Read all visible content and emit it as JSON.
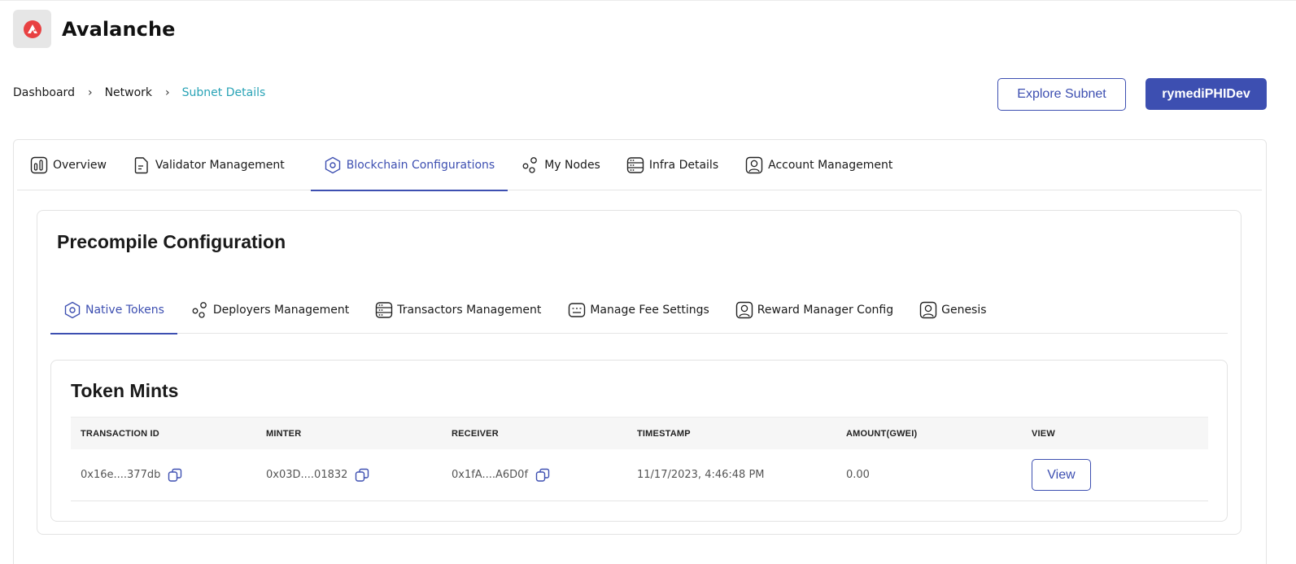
{
  "app": {
    "title": "Avalanche",
    "logo_icon": "avalanche-logo-icon"
  },
  "breadcrumb": {
    "items": [
      "Dashboard",
      "Network",
      "Subnet Details"
    ],
    "separator": "›"
  },
  "header_buttons": {
    "explore": "Explore Subnet",
    "user": "rymediPHIDev"
  },
  "tabs": [
    {
      "label": "Overview",
      "icon": "chart-icon",
      "active": false
    },
    {
      "label": "Validator Management",
      "icon": "document-icon",
      "active": false
    },
    {
      "label": "Blockchain Configurations",
      "icon": "hexagon-icon",
      "active": true
    },
    {
      "label": "My Nodes",
      "icon": "nodes-icon",
      "active": false
    },
    {
      "label": "Infra Details",
      "icon": "server-icon",
      "active": false
    },
    {
      "label": "Account Management",
      "icon": "user-icon",
      "active": false
    }
  ],
  "precompile": {
    "title": "Precompile Configuration"
  },
  "subtabs": [
    {
      "label": "Native Tokens",
      "icon": "hexagon-icon",
      "active": true
    },
    {
      "label": "Deployers Management",
      "icon": "nodes-icon",
      "active": false
    },
    {
      "label": "Transactors Management",
      "icon": "server-icon",
      "active": false
    },
    {
      "label": "Manage Fee Settings",
      "icon": "fee-icon",
      "active": false
    },
    {
      "label": "Reward Manager Config",
      "icon": "user-icon",
      "active": false
    },
    {
      "label": "Genesis",
      "icon": "user-icon",
      "active": false
    }
  ],
  "token_mints": {
    "title": "Token Mints",
    "columns": [
      "TRANSACTION ID",
      "MINTER",
      "RECEIVER",
      "TIMESTAMP",
      "AMOUNT(GWEI)",
      "VIEW"
    ],
    "rows": [
      {
        "tx_id": "0x16e....377db",
        "minter": "0x03D....01832",
        "receiver": "0x1fA....A6D0f",
        "timestamp": "11/17/2023, 4:46:48 PM",
        "amount": "0.00",
        "view_label": "View"
      }
    ]
  },
  "colors": {
    "accent": "#3d4fb1",
    "breadcrumb_current": "#29a3b6",
    "logo_red": "#e84142"
  }
}
